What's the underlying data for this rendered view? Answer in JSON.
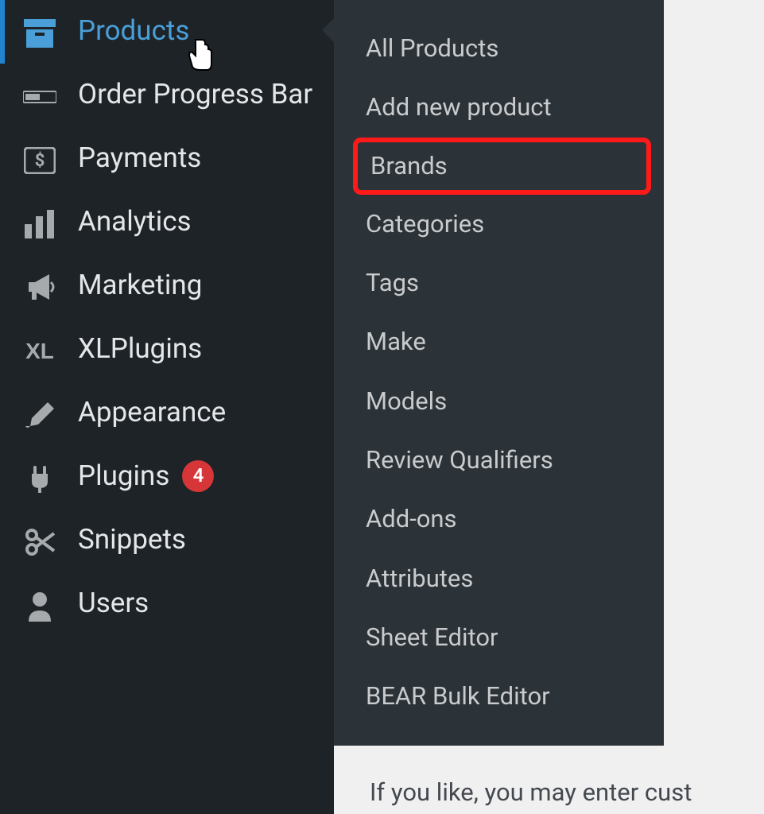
{
  "sidebar": {
    "items": [
      {
        "label": "Products",
        "active": true,
        "icon": "archive-box-icon"
      },
      {
        "label": "Order Progress Bar",
        "icon": "progress-bar-icon"
      },
      {
        "label": "Payments",
        "icon": "dollar-box-icon"
      },
      {
        "label": "Analytics",
        "icon": "bar-chart-icon"
      },
      {
        "label": "Marketing",
        "icon": "megaphone-icon"
      },
      {
        "label": "XLPlugins",
        "icon": "xl-text-icon"
      },
      {
        "label": "Appearance",
        "icon": "paintbrush-icon"
      },
      {
        "label": "Plugins",
        "icon": "plug-icon",
        "badge": "4"
      },
      {
        "label": "Snippets",
        "icon": "scissors-icon"
      },
      {
        "label": "Users",
        "icon": "user-icon"
      }
    ]
  },
  "submenu": {
    "items": [
      {
        "label": "All Products"
      },
      {
        "label": "Add new product"
      },
      {
        "label": "Brands",
        "highlighted": true
      },
      {
        "label": "Categories"
      },
      {
        "label": "Tags"
      },
      {
        "label": "Make"
      },
      {
        "label": "Models"
      },
      {
        "label": "Review Qualifiers"
      },
      {
        "label": "Add-ons"
      },
      {
        "label": "Attributes"
      },
      {
        "label": "Sheet Editor"
      },
      {
        "label": "BEAR Bulk Editor"
      }
    ]
  },
  "content": {
    "snippet": "If you like, you may enter cust"
  }
}
